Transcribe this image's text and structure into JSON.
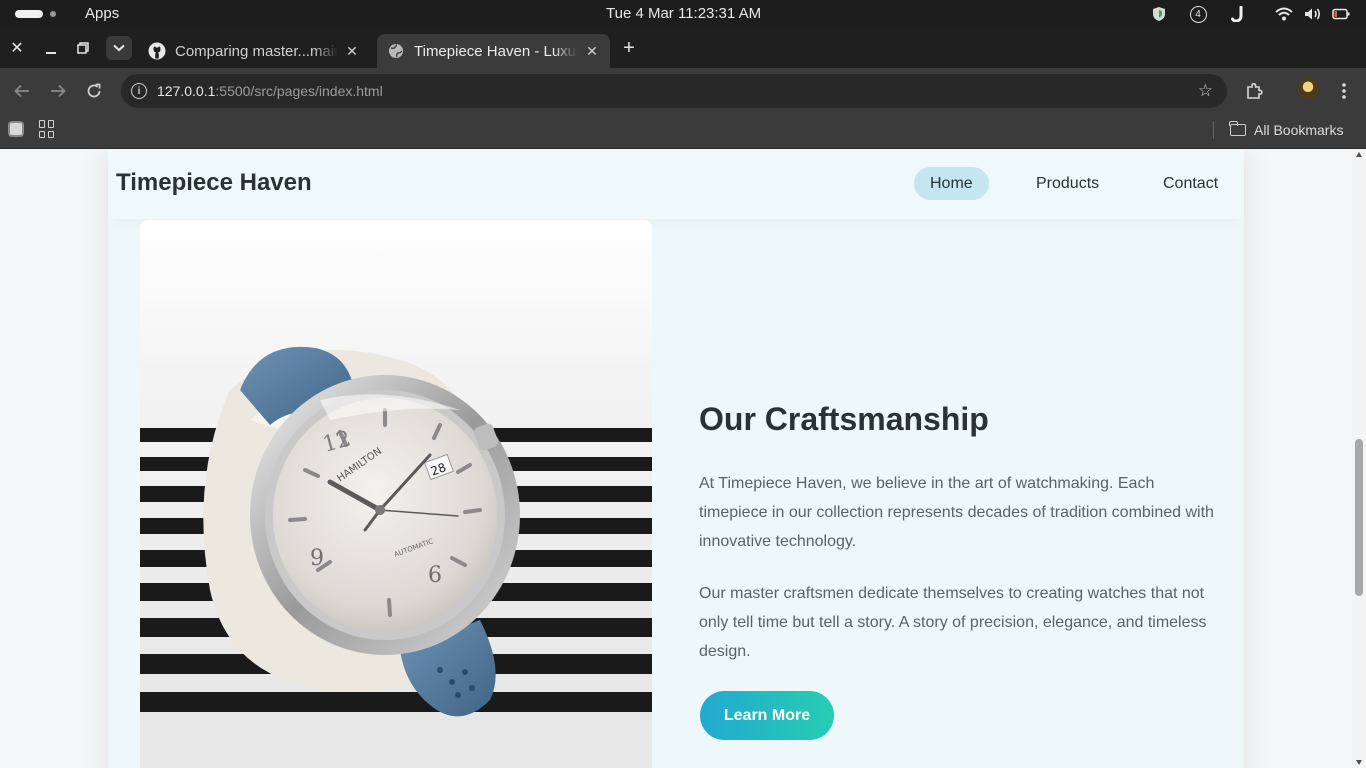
{
  "os": {
    "apps_label": "Apps",
    "clock": "Tue 4 Mar  11:23:31 AM",
    "notification_count": "4"
  },
  "browser": {
    "tabs": [
      {
        "title": "Comparing master...main",
        "favicon": "github-icon",
        "active": false
      },
      {
        "title": "Timepiece Haven - Luxury",
        "favicon": "globe-icon",
        "active": true
      }
    ],
    "url_host": "127.0.0.1",
    "url_path": ":5500/src/pages/index.html",
    "all_bookmarks_label": "All Bookmarks"
  },
  "site": {
    "logo": "Timepiece Haven",
    "nav": [
      {
        "label": "Home",
        "active": true
      },
      {
        "label": "Products",
        "active": false
      },
      {
        "label": "Contact",
        "active": false
      }
    ],
    "section": {
      "title": "Our Craftsmanship",
      "paragraph1": "At Timepiece Haven, we believe in the art of watchmaking. Each timepiece in our collection represents decades of tradition combined with innovative technology.",
      "paragraph2": "Our master craftsmen dedicate themselves to creating watches that not only tell time but tell a story. A story of precision, elegance, and timeless design.",
      "button": "Learn More"
    },
    "watch_brand": "HAMILTON",
    "watch_dial_text": "AUTOMATIC",
    "watch_date": "28"
  },
  "colors": {
    "accent_start": "#21a9d0",
    "accent_end": "#27cdb3",
    "nav_active_bg": "#c3e6f1",
    "card_bg": "#eef8fa"
  }
}
